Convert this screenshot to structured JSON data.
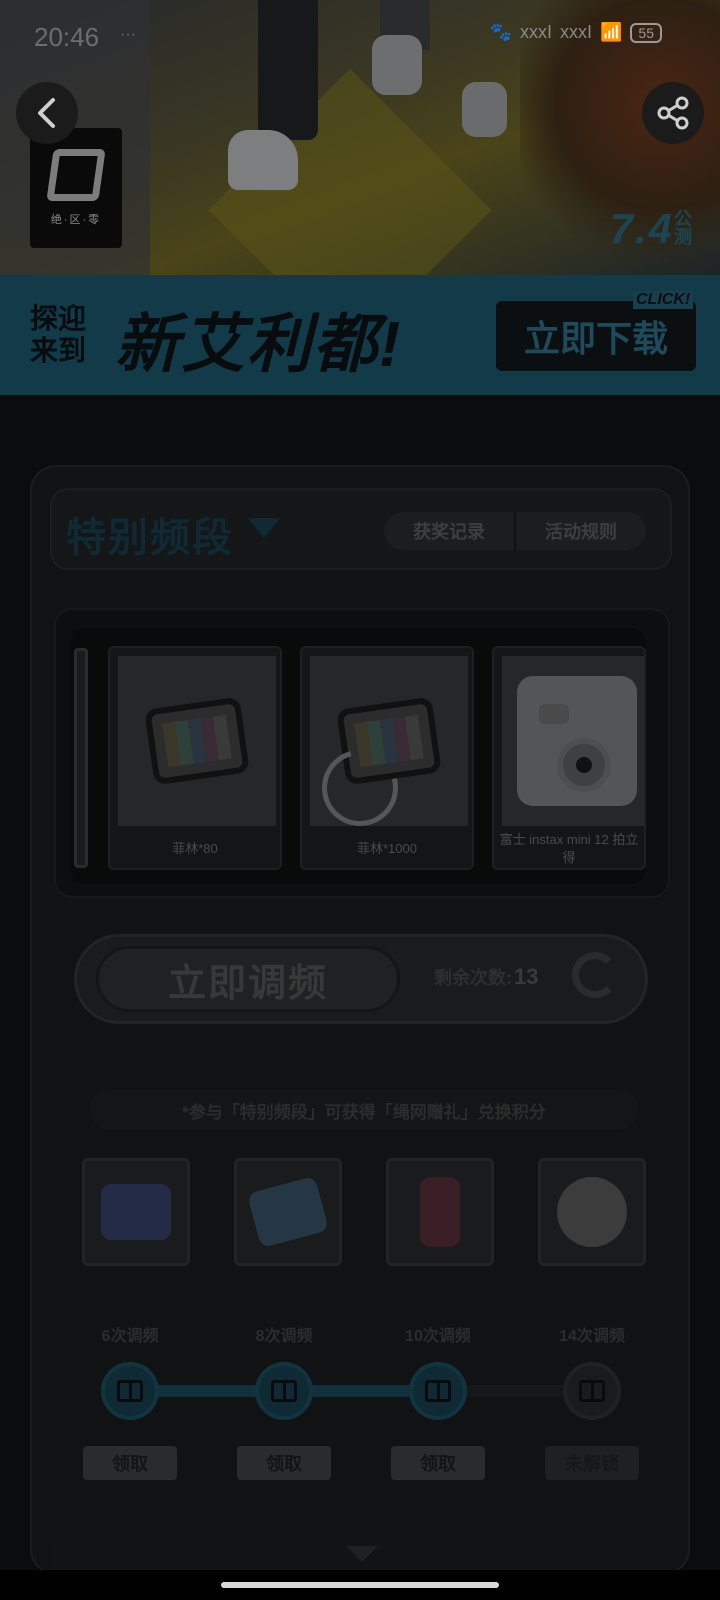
{
  "status_bar": {
    "time": "20:46",
    "notification_dots": "···",
    "signal_text_1": "xxxI",
    "signal_text_2": "xxxI",
    "battery": "55"
  },
  "hero": {
    "logo_text": "绝·区·零",
    "date_tag": "7.4",
    "date_suffix": "公测"
  },
  "banner": {
    "small_text": "探迎来到",
    "headline": "新艾利都!",
    "download_label": "立即下载",
    "click_tag": "CLICK!"
  },
  "header": {
    "title": "特别频段",
    "records_label": "获奖记录",
    "rules_label": "活动规则"
  },
  "prizes": [
    {
      "name": "菲林*80"
    },
    {
      "name": "菲林*1000"
    },
    {
      "name": "富士 instax mini 12 拍立得"
    }
  ],
  "tune": {
    "button_label": "立即调频",
    "remaining_label": "剩余次数:",
    "remaining_count": "13"
  },
  "notice": "*参与「特别频段」可获得「绳网赠礼」兑换积分",
  "milestones": [
    {
      "label": "6次调频",
      "action": "领取"
    },
    {
      "label": "8次调频",
      "action": "领取"
    },
    {
      "label": "10次调频",
      "action": "领取"
    },
    {
      "label": "14次调频",
      "action": "未解锁"
    }
  ],
  "colors": {
    "accent": "#123a48",
    "accent_text": "#0f2a34",
    "background": "#0b0c0d"
  }
}
